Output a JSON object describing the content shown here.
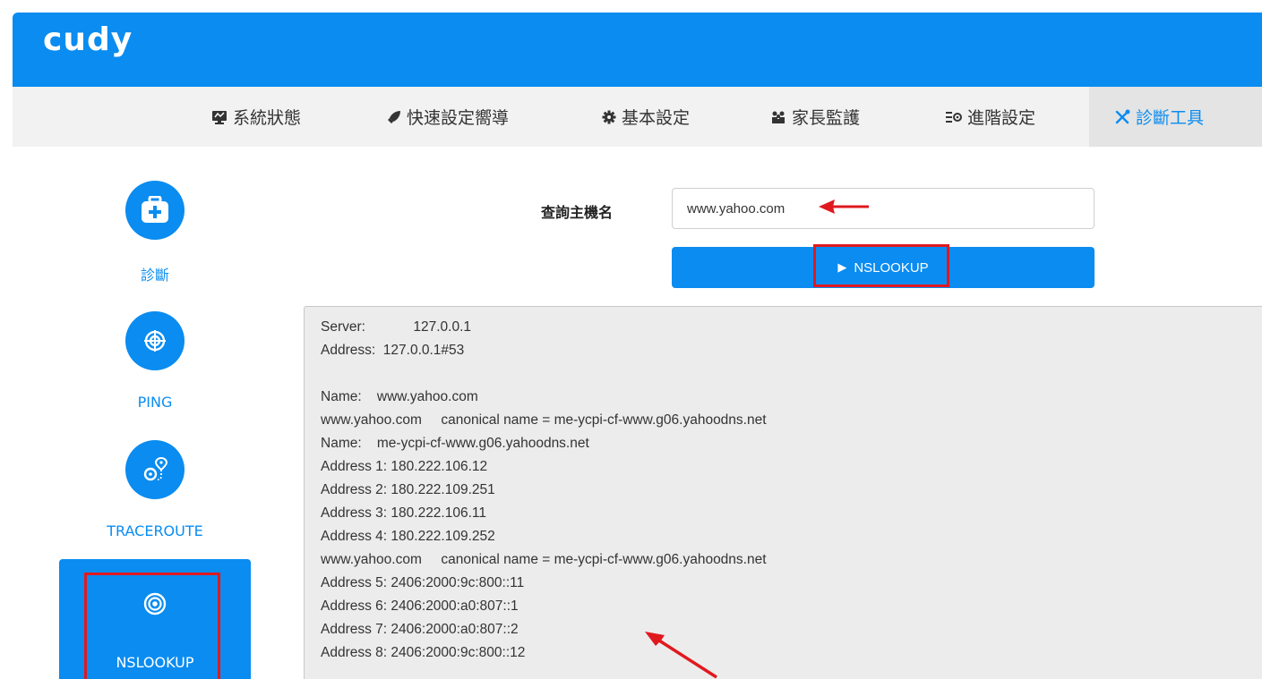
{
  "app": {
    "logo": "cudy"
  },
  "nav": {
    "items": [
      {
        "label": "系統狀態",
        "icon": "monitor-icon"
      },
      {
        "label": "快速設定嚮導",
        "icon": "rocket-icon"
      },
      {
        "label": "基本設定",
        "icon": "gear-icon"
      },
      {
        "label": "家長監護",
        "icon": "users-icon"
      },
      {
        "label": "進階設定",
        "icon": "sliders-icon"
      },
      {
        "label": "診斷工具",
        "icon": "tools-icon",
        "active": true
      }
    ]
  },
  "sidebar": {
    "items": [
      {
        "label": "診斷",
        "icon": "medkit-icon"
      },
      {
        "label": "PING",
        "icon": "target-icon"
      },
      {
        "label": "TRACEROUTE",
        "icon": "route-icon"
      },
      {
        "label": "NSLOOKUP",
        "icon": "eye-icon",
        "active": true
      }
    ]
  },
  "form": {
    "host_label": "查詢主機名",
    "host_value": "www.yahoo.com",
    "button_label": "NSLOOKUP"
  },
  "output": {
    "lines": [
      "Server:\t\t127.0.0.1",
      "Address:  127.0.0.1#53",
      "",
      "Name:    www.yahoo.com",
      "www.yahoo.com     canonical name = me-ycpi-cf-www.g06.yahoodns.net",
      "Name:    me-ycpi-cf-www.g06.yahoodns.net",
      "Address 1: 180.222.106.12",
      "Address 2: 180.222.109.251",
      "Address 3: 180.222.106.11",
      "Address 4: 180.222.109.252",
      "www.yahoo.com     canonical name = me-ycpi-cf-www.g06.yahoodns.net",
      "Address 5: 2406:2000:9c:800::11",
      "Address 6: 2406:2000:a0:807::1",
      "Address 7: 2406:2000:a0:807::2",
      "Address 8: 2406:2000:9c:800::12"
    ]
  },
  "colors": {
    "brand": "#0a8cf0",
    "highlight": "#e0191f"
  }
}
